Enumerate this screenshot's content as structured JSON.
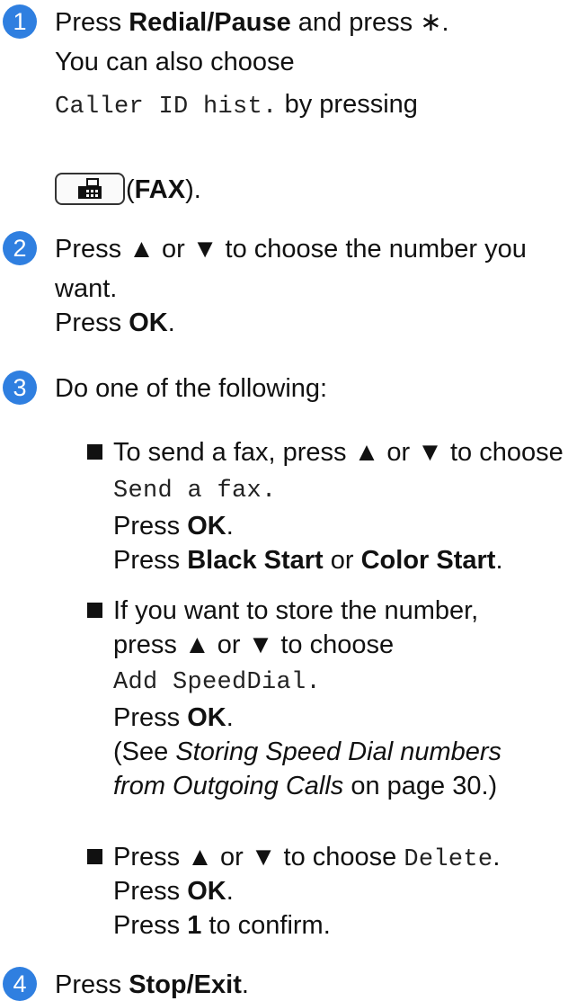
{
  "steps": [
    {
      "num": "1",
      "l1a": "Press ",
      "l1b": "Redial/Pause",
      "l1c": " and press ",
      "l1d": "∗",
      "l1e": ".",
      "l2": "You can also choose",
      "l3a": "Caller ID hist.",
      "l3b": " by pressing",
      "l4a": " (",
      "l4b": "FAX",
      "l4c": ")."
    },
    {
      "num": "2",
      "l1": "Press ▲ or ▼ to choose the number you",
      "l2": "want.",
      "l3a": "Press ",
      "l3b": "OK",
      "l3c": "."
    },
    {
      "num": "3",
      "l1": "Do one of the following:",
      "b1": {
        "l1": "To send a fax, press ▲ or ▼ to choose",
        "l2": "Send a fax.",
        "l3a": "Press ",
        "l3b": "OK",
        "l3c": ".",
        "l4a": "Press ",
        "l4b": "Black Start",
        "l4c": " or ",
        "l4d": "Color Start",
        "l4e": "."
      },
      "b2": {
        "l1": "If you want to store the number,",
        "l2": "press ▲ or ▼ to choose",
        "l3": "Add SpeedDial.",
        "l4a": "Press ",
        "l4b": "OK",
        "l4c": ".",
        "l5a": "(See ",
        "l5b": "Storing Speed Dial numbers",
        "l6a": "from Outgoing Calls",
        "l6b": " on page 30.)"
      },
      "b3": {
        "l1a": "Press ▲ or ▼ to choose ",
        "l1b": "Delete",
        "l1c": ".",
        "l2a": "Press ",
        "l2b": "OK",
        "l2c": ".",
        "l3a": "Press ",
        "l3b": "1",
        "l3c": " to confirm."
      }
    },
    {
      "num": "4",
      "l1a": "Press ",
      "l1b": "Stop/Exit",
      "l1c": "."
    }
  ],
  "icons": {
    "fax_button": "fax-icon"
  }
}
